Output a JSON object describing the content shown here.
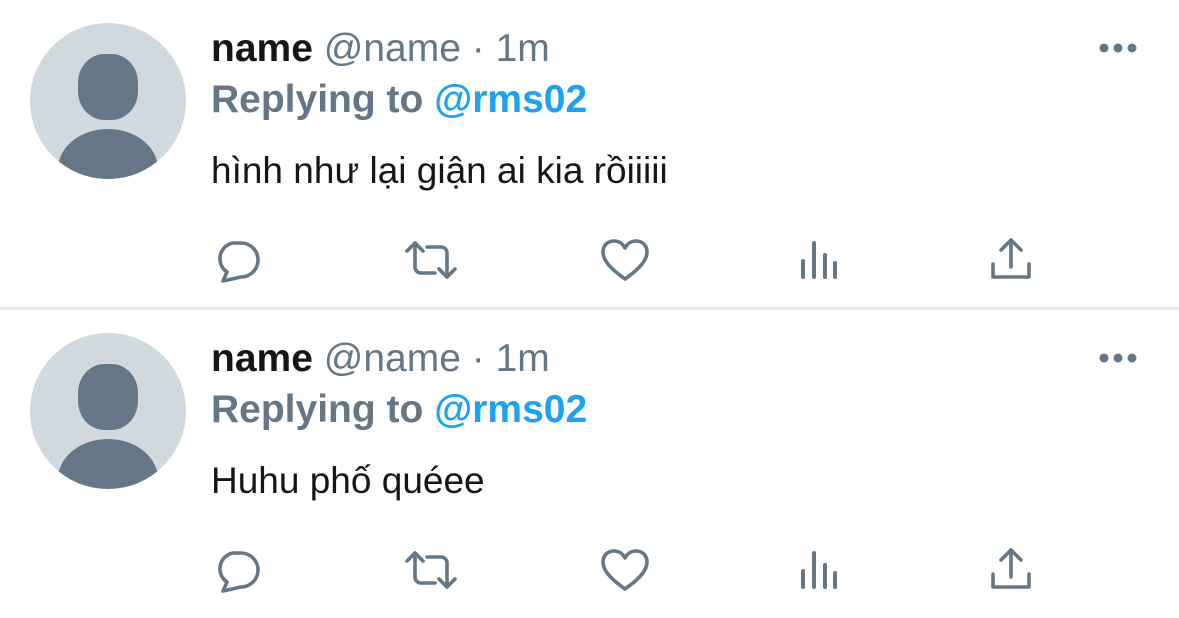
{
  "colors": {
    "text_primary": "#14171a",
    "text_secondary": "#657786",
    "accent": "#1da1f2",
    "avatar_bg": "#cfd9de",
    "divider": "#e6e9ec"
  },
  "icons": {
    "more": "ellipsis-icon",
    "reply": "reply-icon",
    "retweet": "retweet-icon",
    "like": "heart-icon",
    "stats": "analytics-icon",
    "share": "share-icon"
  },
  "tweets": [
    {
      "display_name": "name",
      "handle": "@name",
      "separator": "·",
      "time": "1m",
      "reply_label": "Replying to",
      "reply_target": "@rms02",
      "text": "hình như lại giận ai kia rồiiiii"
    },
    {
      "display_name": "name",
      "handle": "@name",
      "separator": "·",
      "time": "1m",
      "reply_label": "Replying to",
      "reply_target": "@rms02",
      "text": "Huhu phố quéee"
    }
  ]
}
